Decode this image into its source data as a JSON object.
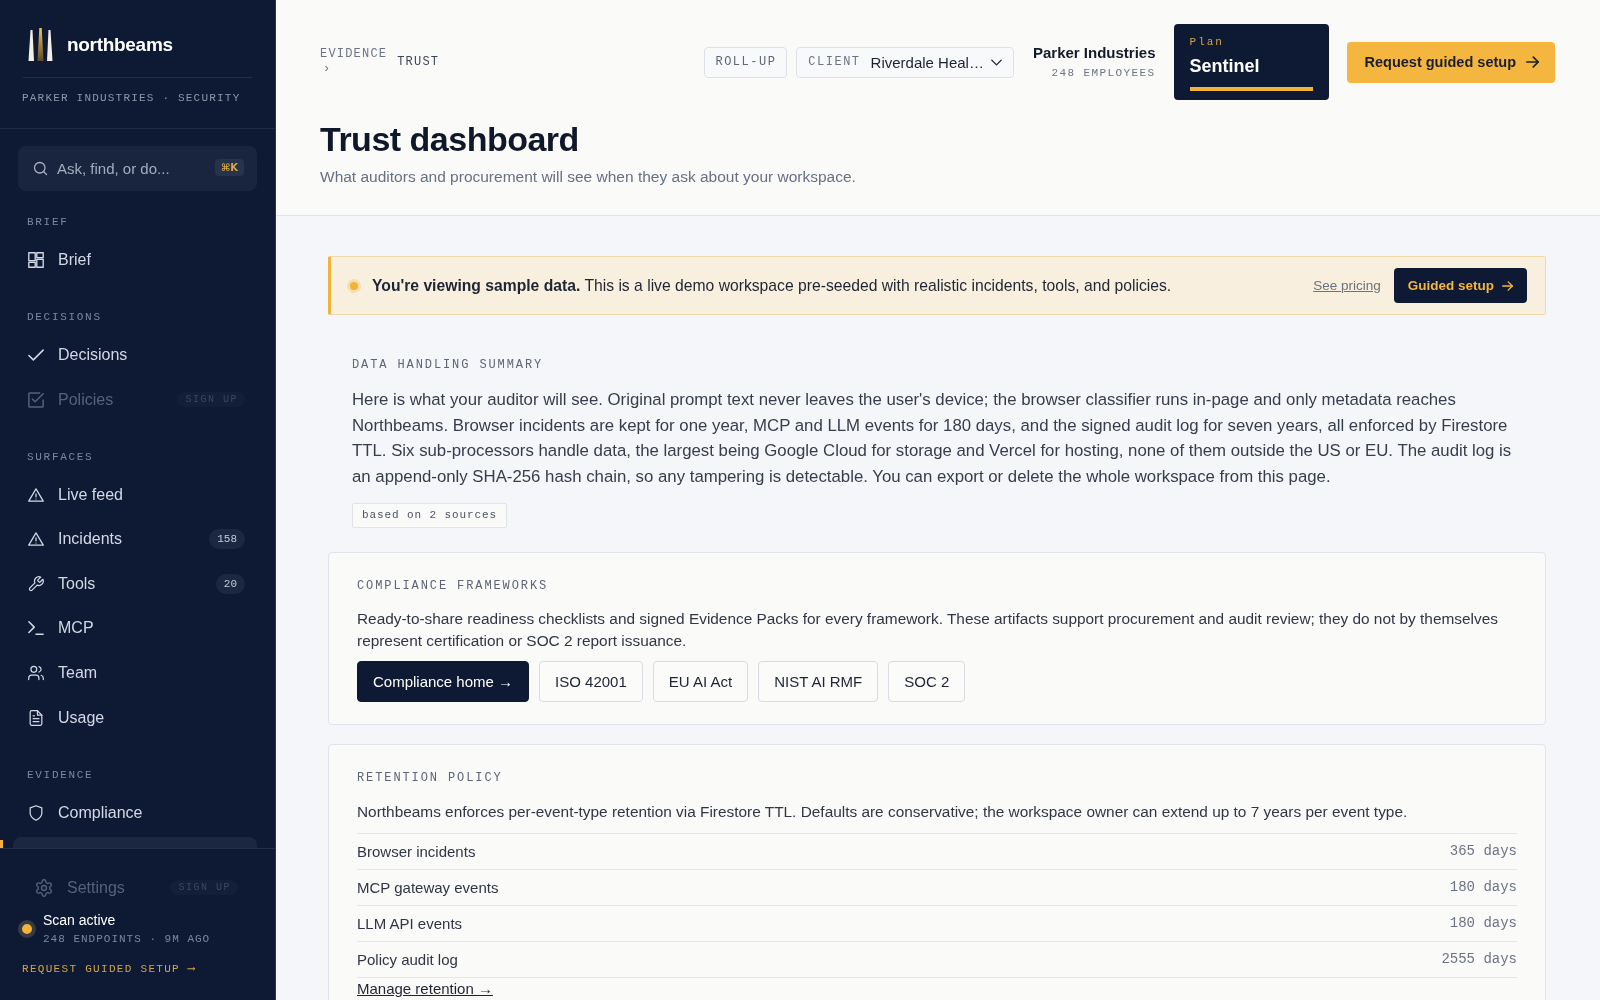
{
  "sidebar": {
    "brand": "northbeams",
    "workspace": "PARKER INDUSTRIES · SECURITY",
    "search": {
      "placeholder": "Ask, find, or do...",
      "shortcut": "⌘K"
    },
    "sections": [
      {
        "heading": "BRIEF",
        "items": [
          {
            "label": "Brief",
            "selected": false,
            "disabled": false
          }
        ]
      },
      {
        "heading": "DECISIONS",
        "items": [
          {
            "label": "Decisions",
            "selected": false,
            "disabled": false
          },
          {
            "label": "Policies",
            "selected": false,
            "disabled": true,
            "badge": "SIGN UP"
          }
        ]
      },
      {
        "heading": "SURFACES",
        "items": [
          {
            "label": "Live feed",
            "selected": false,
            "disabled": false
          },
          {
            "label": "Incidents",
            "selected": false,
            "disabled": false,
            "badge": "158"
          },
          {
            "label": "Tools",
            "selected": false,
            "disabled": false,
            "badge": "20"
          },
          {
            "label": "MCP",
            "selected": false,
            "disabled": false
          },
          {
            "label": "Team",
            "selected": false,
            "disabled": false
          },
          {
            "label": "Usage",
            "selected": false,
            "disabled": false
          }
        ]
      },
      {
        "heading": "EVIDENCE",
        "items": [
          {
            "label": "Compliance",
            "selected": false,
            "disabled": false
          },
          {
            "selected": true,
            "disabled": false
          }
        ]
      }
    ],
    "footer": {
      "settings": {
        "label": "Settings",
        "disabled": true,
        "badge": "SIGN UP"
      },
      "status": {
        "title": "Scan active",
        "detail": "248 ENDPOINTS · 9M AGO",
        "active": true
      },
      "cta": "REQUEST GUIDED SETUP ⟶"
    }
  },
  "header": {
    "breadcrumb": {
      "items": [
        "EVIDENCE",
        "TRUST"
      ],
      "separator": "›"
    },
    "rollup": "ROLL-UP",
    "client": {
      "label": "CLIENT",
      "value": "Riverdale Heal…"
    },
    "org": {
      "name": "Parker Industries",
      "detail": "248 EMPLOYEES"
    },
    "plan": {
      "label": "Plan",
      "name": "Sentinel"
    },
    "cta": "Request guided setup",
    "title": "Trust dashboard",
    "subtitle": "What auditors and procurement will see when they ask about your workspace."
  },
  "banner": {
    "text": "**You're viewing sample data.** This is a live demo workspace pre-seeded with realistic incidents, tools, and policies.",
    "link": "See pricing",
    "button": "Guided setup"
  },
  "data_handling_summary": {
    "heading": "DATA HANDLING SUMMARY",
    "text": "Here is what your auditor will see. Original prompt text never leaves the user's device; the browser classifier runs in-page and only metadata reaches Northbeams. Browser incidents are kept for one year, MCP and LLM events for 180 days, and the signed audit log for seven years, all enforced by Firestore TTL. Six sub-processors handle data, the largest being Google Cloud for storage and Vercel for hosting, none of them outside the US or EU. The audit log is an append-only SHA-256 hash chain, so any tampering is detectable. You can export or delete the whole workspace from this page.",
    "sources": "based on 2 sources"
  },
  "compliance_frameworks": {
    "heading": "COMPLIANCE FRAMEWORKS",
    "text": "Ready-to-share readiness checklists and signed Evidence Packs for every framework. These artifacts support procurement and audit review; they do not by themselves represent certification or SOC 2 report issuance.",
    "buttons": [
      {
        "label": "Compliance home →",
        "kind": "primary"
      },
      {
        "label": "ISO 42001",
        "kind": "outline"
      },
      {
        "label": "EU AI Act",
        "kind": "outline"
      },
      {
        "label": "NIST AI RMF",
        "kind": "outline"
      },
      {
        "label": "SOC 2",
        "kind": "outline"
      }
    ]
  },
  "retention_policy": {
    "heading": "RETENTION POLICY",
    "text": "Northbeams enforces per-event-type retention via Firestore TTL. Defaults are conservative; the workspace owner can extend up to 7 years per event type.",
    "rows": [
      {
        "label": "Browser incidents",
        "value": "365 days"
      },
      {
        "label": "MCP gateway events",
        "value": "180 days"
      },
      {
        "label": "LLM API events",
        "value": "180 days"
      },
      {
        "label": "Policy audit log",
        "value": "2555 days"
      }
    ],
    "link": "Manage retention →"
  }
}
